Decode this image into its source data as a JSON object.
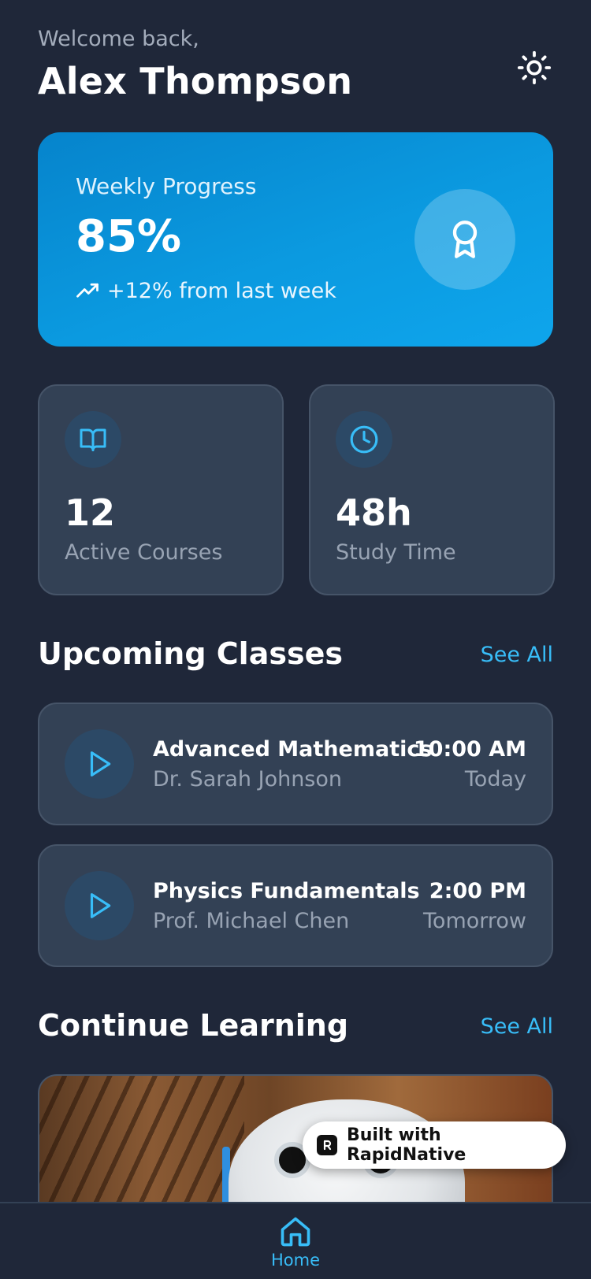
{
  "header": {
    "welcome": "Welcome back,",
    "username": "Alex Thompson",
    "theme_icon": "sun-icon"
  },
  "progress": {
    "label": "Weekly Progress",
    "value": "85%",
    "trend": "+12% from last week",
    "trend_icon": "trending-up-icon",
    "badge_icon": "award-icon"
  },
  "stats": [
    {
      "icon": "book-open-icon",
      "value": "12",
      "label": "Active Courses"
    },
    {
      "icon": "clock-icon",
      "value": "48h",
      "label": "Study Time"
    }
  ],
  "upcoming": {
    "title": "Upcoming Classes",
    "see_all": "See All",
    "classes": [
      {
        "title": "Advanced Mathematics",
        "teacher": "Dr. Sarah Johnson",
        "time": "10:00 AM",
        "day": "Today"
      },
      {
        "title": "Physics Fundamentals",
        "teacher": "Prof. Michael Chen",
        "time": "2:00 PM",
        "day": "Tomorrow"
      }
    ]
  },
  "continue": {
    "title": "Continue Learning",
    "see_all": "See All"
  },
  "badge": {
    "text": "Built with RapidNative"
  },
  "nav": {
    "home_label": "Home"
  },
  "colors": {
    "background": "#1f2739",
    "card": "#334155",
    "accent": "#38bdf8",
    "progress_gradient_start": "#0684cc",
    "progress_gradient_end": "#0ea5ec"
  }
}
